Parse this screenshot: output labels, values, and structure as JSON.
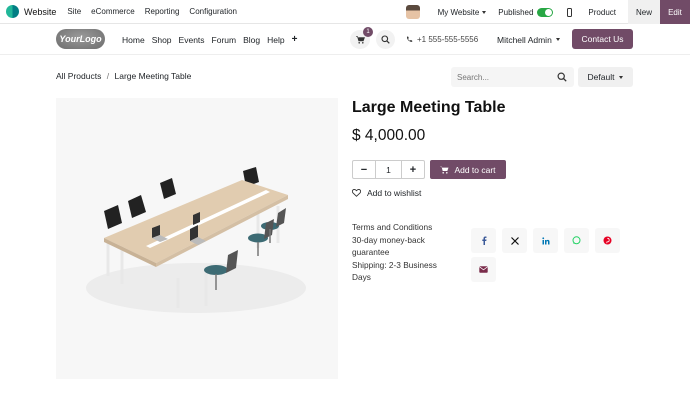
{
  "admin_bar": {
    "app_name": "Website",
    "menu": [
      "Site",
      "eCommerce",
      "Reporting",
      "Configuration"
    ],
    "my_website": "My Website",
    "published": "Published",
    "product": "Product",
    "new": "New",
    "edit": "Edit"
  },
  "site_nav": {
    "logo_text": "YourLogo",
    "links": [
      "Home",
      "Shop",
      "Events",
      "Forum",
      "Blog",
      "Help"
    ],
    "cart_count": "1",
    "phone": "+1 555-555-5556",
    "user": "Mitchell Admin",
    "contact": "Contact Us"
  },
  "breadcrumb": {
    "parent": "All Products",
    "separator": "/",
    "current": "Large Meeting Table"
  },
  "search": {
    "placeholder": "Search..."
  },
  "sort": {
    "label": "Default"
  },
  "product": {
    "title": "Large Meeting Table",
    "price": "$ 4,000.00",
    "quantity": "1",
    "add_to_cart": "Add to cart",
    "wishlist": "Add to wishlist",
    "terms": [
      "Terms and Conditions",
      "30-day money-back guarantee",
      "Shipping: 2-3 Business Days"
    ]
  },
  "share_icons": [
    "facebook-icon",
    "x-icon",
    "linkedin-icon",
    "whatsapp-icon",
    "pinterest-icon",
    "email-icon"
  ],
  "colors": {
    "brand": "#714b67",
    "toggle_on": "#28a745"
  }
}
